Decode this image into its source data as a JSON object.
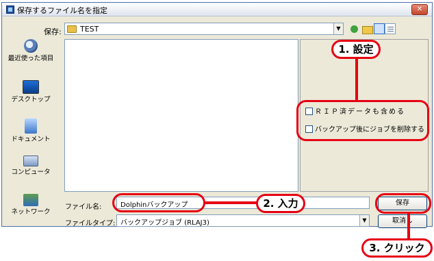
{
  "window": {
    "title": "保存するファイル名を指定",
    "close_label": "✕"
  },
  "look_in": {
    "label": "保存:",
    "value": "TEST",
    "arrow": "▼"
  },
  "places": [
    {
      "label": "最近使った項目",
      "icon": "recent-places-icon"
    },
    {
      "label": "デスクトップ",
      "icon": "desktop-icon"
    },
    {
      "label": "ドキュメント",
      "icon": "documents-icon"
    },
    {
      "label": "コンピュータ",
      "icon": "computer-icon"
    },
    {
      "label": "ネットワーク",
      "icon": "network-icon"
    }
  ],
  "options": [
    {
      "label": "ＲＩＰ済データも含める",
      "checked": false
    },
    {
      "label": "バックアップ後にジョブを削除する",
      "checked": false
    }
  ],
  "file_name": {
    "label": "ファイル名:",
    "value": "Dolphinバックアップ"
  },
  "file_type": {
    "label": "ファイルタイプ:",
    "value": "バックアップジョブ (RLAJ3)",
    "arrow": "▼"
  },
  "buttons": {
    "save": "保存",
    "cancel": "取消し"
  },
  "annotations": {
    "step1": "1. 設定",
    "step2": "2. 入力",
    "step3": "3. クリック",
    "color": "#e60012"
  }
}
